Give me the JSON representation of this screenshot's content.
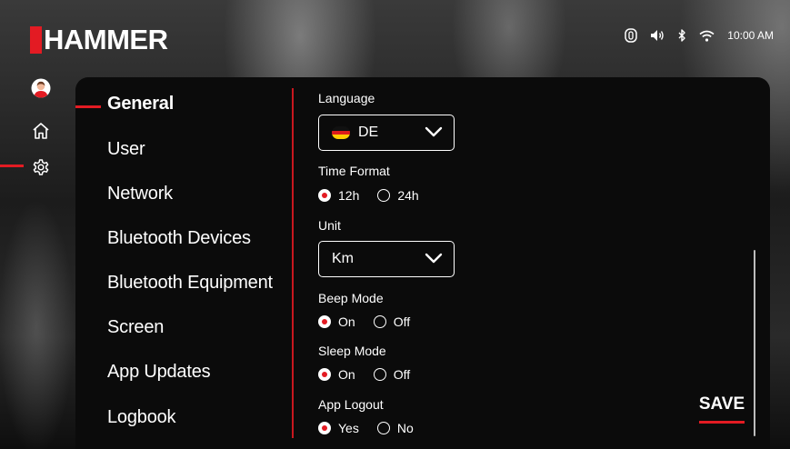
{
  "brand": {
    "logo_text": "HAMMER",
    "accent_color": "#e31b23"
  },
  "status_bar": {
    "icons": [
      "device-icon",
      "volume-icon",
      "bluetooth-icon",
      "wifi-icon"
    ],
    "time": "10:00 AM"
  },
  "rail": {
    "items": [
      {
        "name": "profile",
        "icon": "avatar-icon"
      },
      {
        "name": "home",
        "icon": "home-icon"
      },
      {
        "name": "settings",
        "icon": "gear-icon",
        "active": true
      }
    ]
  },
  "settings_menu": {
    "items": [
      {
        "label": "General",
        "active": true
      },
      {
        "label": "User"
      },
      {
        "label": "Network"
      },
      {
        "label": "Bluetooth Devices"
      },
      {
        "label": "Bluetooth Equipment"
      },
      {
        "label": "Screen"
      },
      {
        "label": "App Updates"
      },
      {
        "label": "Logbook"
      }
    ]
  },
  "general": {
    "language": {
      "label": "Language",
      "value": "DE",
      "flag": "germany-flag-icon"
    },
    "time_format": {
      "label": "Time Format",
      "options": [
        "12h",
        "24h"
      ],
      "selected": "12h"
    },
    "unit": {
      "label": "Unit",
      "value": "Km"
    },
    "beep_mode": {
      "label": "Beep Mode",
      "options": [
        "On",
        "Off"
      ],
      "selected": "On"
    },
    "sleep_mode": {
      "label": "Sleep Mode",
      "options": [
        "On",
        "Off"
      ],
      "selected": "On"
    },
    "app_logout": {
      "label": "App Logout",
      "options": [
        "Yes",
        "No"
      ],
      "selected": "Yes"
    }
  },
  "actions": {
    "save_label": "SAVE"
  }
}
